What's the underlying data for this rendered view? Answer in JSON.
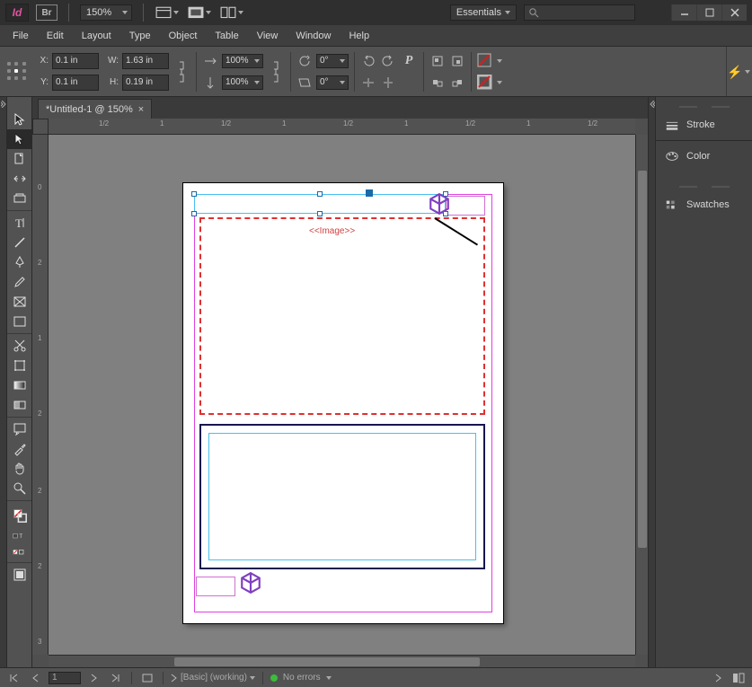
{
  "app": {
    "name": "Id",
    "bridge_label": "Br",
    "zoom_label": "150%",
    "workspace": "Essentials"
  },
  "menu": [
    "File",
    "Edit",
    "Layout",
    "Type",
    "Object",
    "Table",
    "View",
    "Window",
    "Help"
  ],
  "controlbar": {
    "x": "0.1 in",
    "y": "0.1 in",
    "w": "1.63 in",
    "h": "0.19 in",
    "x_label": "X:",
    "y_label": "Y:",
    "w_label": "W:",
    "h_label": "H:",
    "scale_x": "100%",
    "scale_y": "100%",
    "rotate": "0°",
    "shear": "0°"
  },
  "doc": {
    "tab_label": "*Untitled-1 @ 150%"
  },
  "canvas": {
    "image_tag": "<<Image>>"
  },
  "rulers": {
    "h": [
      {
        "pos": 56,
        "label": "1/2"
      },
      {
        "pos": 124,
        "label": "1"
      },
      {
        "pos": 192,
        "label": "1/2"
      },
      {
        "pos": 260,
        "label": "1"
      },
      {
        "pos": 328,
        "label": "1/2"
      },
      {
        "pos": 396,
        "label": "1"
      },
      {
        "pos": 464,
        "label": "1/2"
      },
      {
        "pos": 532,
        "label": "1"
      },
      {
        "pos": 600,
        "label": "1/2"
      },
      {
        "pos": 654,
        "label": "1/2"
      }
    ],
    "v": [
      {
        "pos": 54,
        "label": "0"
      },
      {
        "pos": 138,
        "label": "2"
      },
      {
        "pos": 222,
        "label": "1"
      },
      {
        "pos": 306,
        "label": "2"
      },
      {
        "pos": 392,
        "label": "2"
      },
      {
        "pos": 476,
        "label": "2"
      },
      {
        "pos": 560,
        "label": "3"
      }
    ]
  },
  "panels": [
    "Stroke",
    "Color",
    "Swatches"
  ],
  "status": {
    "page": "1",
    "master_label": " [Basic] (working)",
    "errors_label": "No errors"
  }
}
